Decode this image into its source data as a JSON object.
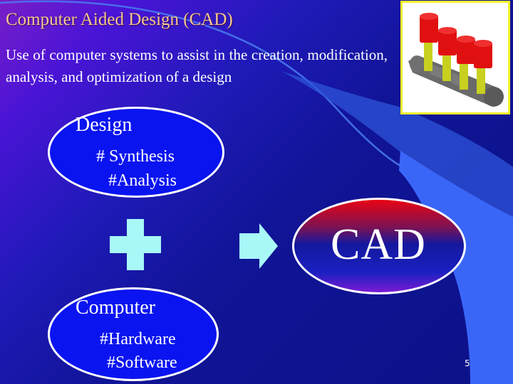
{
  "slide": {
    "title": "Computer Aided Design (CAD)",
    "description": "Use of computer systems to assist in the creation, modification, analysis, and optimization of a design",
    "picture": {
      "icon": "engine-crankshaft-pistons-icon",
      "border_color": "#f2f22a"
    },
    "design_ellipse": {
      "heading": "Design",
      "items": [
        "# Synthesis",
        "#Analysis"
      ],
      "fill_color": "#0a14f0"
    },
    "computer_ellipse": {
      "heading": "Computer",
      "items": [
        "#Hardware",
        "#Software"
      ],
      "fill_color": "#0a14f0"
    },
    "operator_icon": "plus-icon",
    "result_arrow_icon": "arrow-right-icon",
    "result_ellipse": {
      "label": "CAD"
    },
    "symbol_color": "#a8f8f8",
    "accent_band_color": "#3a66f8",
    "title_color": "#f5c890",
    "page_number": "5"
  }
}
